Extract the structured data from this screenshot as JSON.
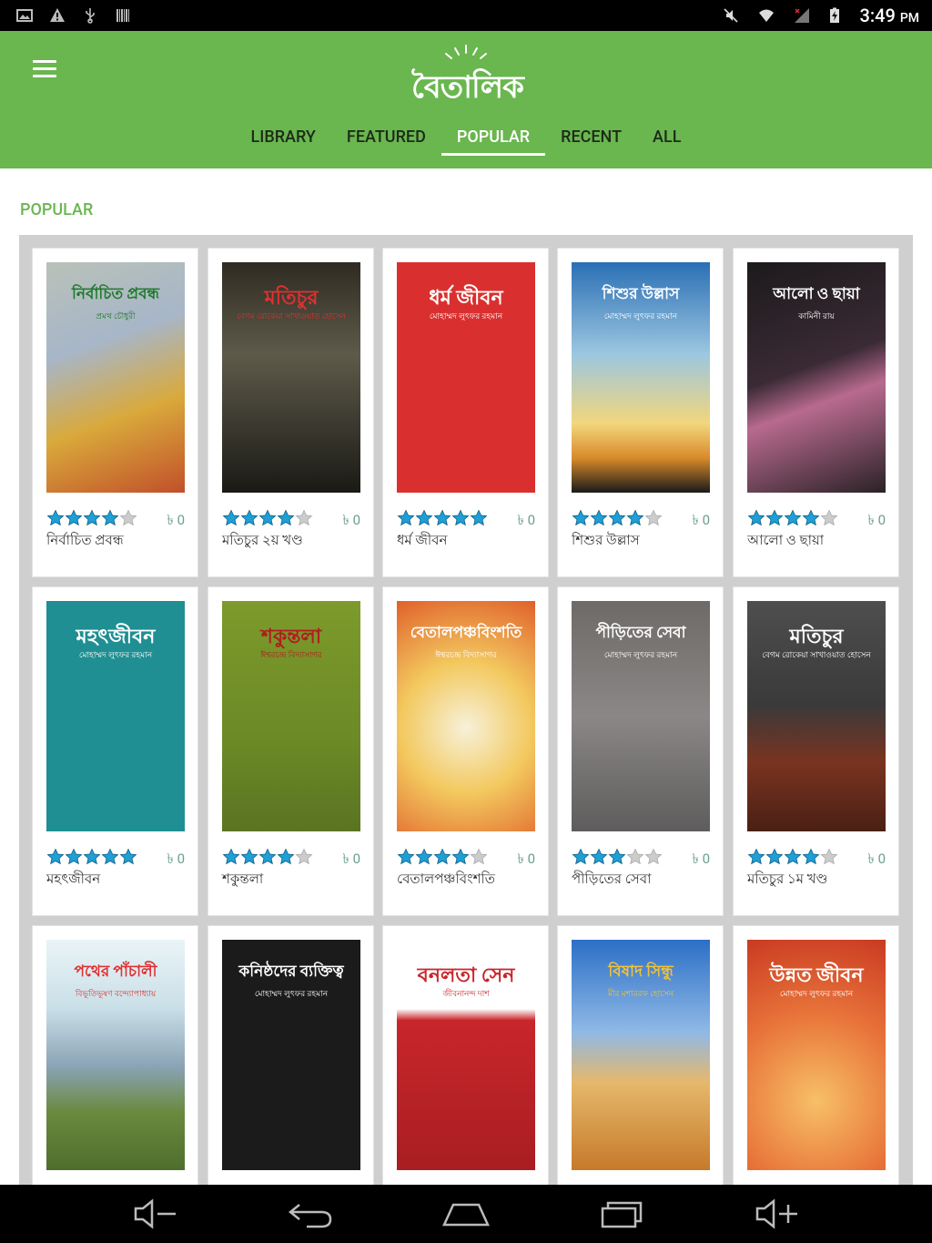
{
  "status_bar": {
    "time": "3:49",
    "ampm": "PM"
  },
  "app": {
    "logo_text": "বৈতালিক"
  },
  "tabs": [
    {
      "label": "LIBRARY",
      "active": false
    },
    {
      "label": "FEATURED",
      "active": false
    },
    {
      "label": "POPULAR",
      "active": true
    },
    {
      "label": "RECENT",
      "active": false
    },
    {
      "label": "ALL",
      "active": false
    }
  ],
  "section": {
    "title": "POPULAR"
  },
  "colors": {
    "brand_green": "#6ab64f",
    "star_blue": "#1f9fd6",
    "star_grey": "#cccccc"
  },
  "books": [
    {
      "title": "নির্বাচিত প্রবন্ধ",
      "rating": 4,
      "price": "৳ 0",
      "cover_title": "নির্বাচিত প্রবন্ধ",
      "cover_author": "প্রমথ চৌধুরী",
      "cover_bg": "linear-gradient(160deg,#b9c1b8 0%,#a7b6c9 35%,#d9a93b 65%,#c1502a 100%)",
      "title_color": "#1d7a2a"
    },
    {
      "title": "মতিচুর ২য় খণ্ড",
      "rating": 4,
      "price": "৳ 0",
      "cover_title": "মতিচুর",
      "cover_author": "বেগম রোকেয়া সাখাওয়াত হোসেন",
      "cover_bg": "linear-gradient(180deg,#2f2b22 0%,#5e5a4a 40%,#3c3a30 70%,#1a1a14 100%)",
      "title_color": "#e03030"
    },
    {
      "title": "ধর্ম জীবন",
      "rating": 5,
      "price": "৳ 0",
      "cover_title": "ধর্ম জীবন",
      "cover_author": "মোহাম্মদ লুৎফর রহমান",
      "cover_bg": "#d9302f",
      "title_color": "#ffffff"
    },
    {
      "title": "শিশুর উল্লাস",
      "rating": 4,
      "price": "৳ 0",
      "cover_title": "শিশুর উল্লাস",
      "cover_author": "মোহাম্মদ লুৎফর রহমান",
      "cover_bg": "linear-gradient(180deg,#2a6fb5 0%,#9cc7e0 40%,#f2d67c 70%,#d98a2a 85%,#1a1a1a 100%)",
      "title_color": "#ffffff"
    },
    {
      "title": "আলো ও ছায়া",
      "rating": 4,
      "price": "৳ 0",
      "cover_title": "আলো ও ছায়া",
      "cover_author": "কামিনী রায়",
      "cover_bg": "linear-gradient(160deg,#1c1a1c 0%,#3a2a34 45%,#b86a8f 60%,#2a2226 100%)",
      "title_color": "#ffffff"
    },
    {
      "title": "মহৎজীবন",
      "rating": 5,
      "price": "৳ 0",
      "cover_title": "মহৎজীবন",
      "cover_author": "মোহাম্মদ লুৎফর রহমান",
      "cover_bg": "#1f8f93",
      "title_color": "#ffffff"
    },
    {
      "title": "শকুন্তলা",
      "rating": 4,
      "price": "৳ 0",
      "cover_title": "শকুন্তলা",
      "cover_author": "ঈশ্বরচন্দ্র বিদ্যাসাগর",
      "cover_bg": "linear-gradient(180deg,#7d9a2b 0%,#6c8a26 60%,#5a7422 100%)",
      "title_color": "#b01e1e"
    },
    {
      "title": "বেতালপঞ্চবিংশতি",
      "rating": 4,
      "price": "৳ 0",
      "cover_title": "বেতালপঞ্চবিংশতি",
      "cover_author": "ঈশ্বরচন্দ্র বিদ্যাসাগর",
      "cover_bg": "radial-gradient(circle at 50% 55%,#f7f1da 0%,#f3c95f 45%,#e0602a 100%)",
      "title_color": "#ffffff"
    },
    {
      "title": "পীড়িতের সেবা",
      "rating": 3,
      "price": "৳ 0",
      "cover_title": "পীড়িতের সেবা",
      "cover_author": "মোহাম্মদ লুৎফর রহমান",
      "cover_bg": "linear-gradient(180deg,#6e6a68 0%,#8a8786 50%,#5e5c5c 100%)",
      "title_color": "#ffffff"
    },
    {
      "title": "মতিচুর ১ম খণ্ড",
      "rating": 4,
      "price": "৳ 0",
      "cover_title": "মতিচুর",
      "cover_author": "বেগম রোকেয়া সাখাওয়াত হোসেন",
      "cover_bg": "linear-gradient(180deg,#4e4e4e 0%,#3a3a3a 45%,#7a3320 70%,#4a2014 100%)",
      "title_color": "#ffffff"
    },
    {
      "title": "",
      "rating": 0,
      "price": "",
      "cover_title": "পথের পাঁচালী",
      "cover_author": "বিভূতিভূষণ বন্দ্যোপাধ্যায়",
      "cover_bg": "linear-gradient(180deg,#eaf4f7 0%,#c9dfe7 30%,#8aa3b6 55%,#6a8a3e 75%,#4e6e2e 100%)",
      "title_color": "#e03030"
    },
    {
      "title": "",
      "rating": 0,
      "price": "",
      "cover_title": "কনিষ্ঠদের ব্যক্তিত্ব",
      "cover_author": "মোহাম্মদ লুৎফর রহমান",
      "cover_bg": "#1b1b1b",
      "title_color": "#ffffff"
    },
    {
      "title": "",
      "rating": 0,
      "price": "",
      "cover_title": "বনলতা সেন",
      "cover_author": "জীবনানন্দ দাশ",
      "cover_bg": "linear-gradient(180deg,#ffffff 0%,#ffffff 30%,#c8262b 35%,#a81e22 100%)",
      "title_color": "#c8262b"
    },
    {
      "title": "",
      "rating": 0,
      "price": "",
      "cover_title": "বিষাদ সিন্ধু",
      "cover_author": "মীর মশাররফ হোসেন",
      "cover_bg": "linear-gradient(180deg,#2c6fc6 0%,#8fb9e6 40%,#e6b86b 62%,#c67a2a 100%)",
      "title_color": "#f0c23a"
    },
    {
      "title": "",
      "rating": 0,
      "price": "",
      "cover_title": "উন্নত জীবন",
      "cover_author": "মোহাম্মদ লুৎফর রহমান",
      "cover_bg": "radial-gradient(circle at 50% 70%,#f7c067 0%,#e8743a 50%,#c93a22 100%)",
      "title_color": "#ffffff"
    }
  ]
}
